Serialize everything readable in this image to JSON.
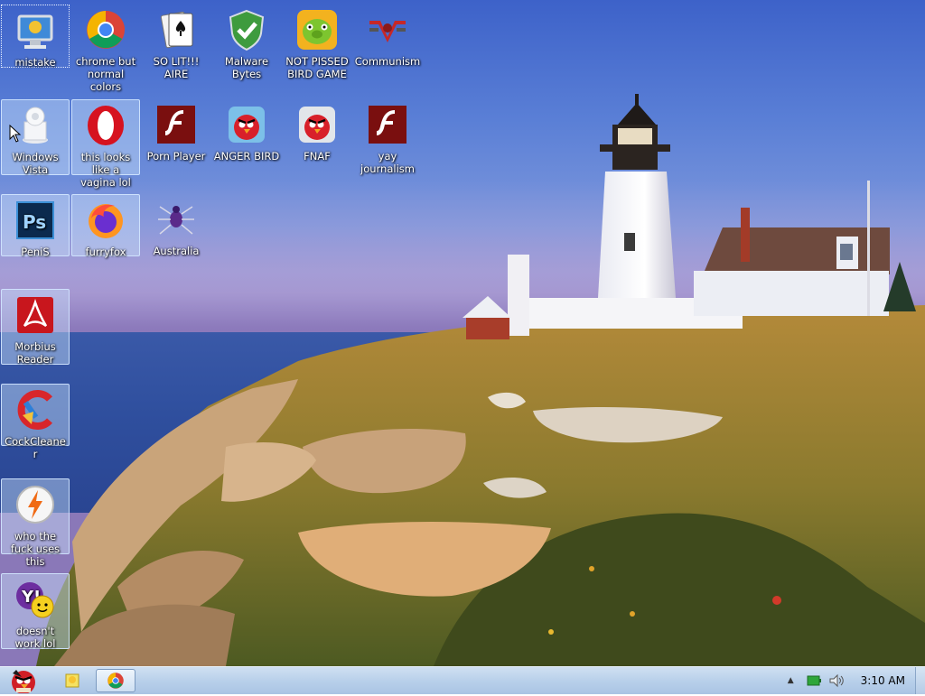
{
  "desktop": {
    "icons": [
      {
        "label": "mistake",
        "icon": "computer-monitor-icon"
      },
      {
        "label": "chrome but normal colors",
        "icon": "chrome-icon"
      },
      {
        "label": "SO LIT!!! AIRE",
        "icon": "solitaire-cards-icon"
      },
      {
        "label": "Malware Bytes",
        "icon": "shield-check-icon"
      },
      {
        "label": "NOT PISSED BIRD GAME",
        "icon": "green-pig-icon"
      },
      {
        "label": "Communism",
        "icon": "hammer-sickle-emblem-icon"
      },
      {
        "label": "Windows Vista",
        "icon": "vista-box-icon"
      },
      {
        "label": "this looks like a vagina lol",
        "icon": "opera-icon"
      },
      {
        "label": "Porn Player",
        "icon": "flash-player-icon"
      },
      {
        "label": "ANGER BIRD",
        "icon": "red-bird-icon"
      },
      {
        "label": "FNAF",
        "icon": "red-bird-icon"
      },
      {
        "label": "yay journalism",
        "icon": "flash-player-icon"
      },
      {
        "label": "PeniS",
        "icon": "photoshop-icon"
      },
      {
        "label": "furryfox",
        "icon": "firefox-icon"
      },
      {
        "label": "Australia",
        "icon": "spider-solitaire-icon"
      },
      {
        "label": "Morbius Reader",
        "icon": "acrobat-reader-icon"
      },
      {
        "label": "CockCleaner",
        "icon": "ccleaner-icon"
      },
      {
        "label": "who the fuck uses this",
        "icon": "winamp-bolt-icon"
      },
      {
        "label": "doesn't work lol",
        "icon": "yahoo-messenger-icon"
      }
    ]
  },
  "taskbar": {
    "start": "start-orb-angry-bird-icon",
    "pinned": [
      "sticky-notes-icon",
      "chrome-icon"
    ],
    "tray": [
      "show-hidden-icons-arrow",
      "network-battery-icon",
      "speaker-volume-icon"
    ],
    "clock": "3:10 AM"
  },
  "colors": {
    "sky_top": "#3d62c9",
    "taskbar": "#b9d0ea",
    "selection": "#c8e1fa"
  }
}
